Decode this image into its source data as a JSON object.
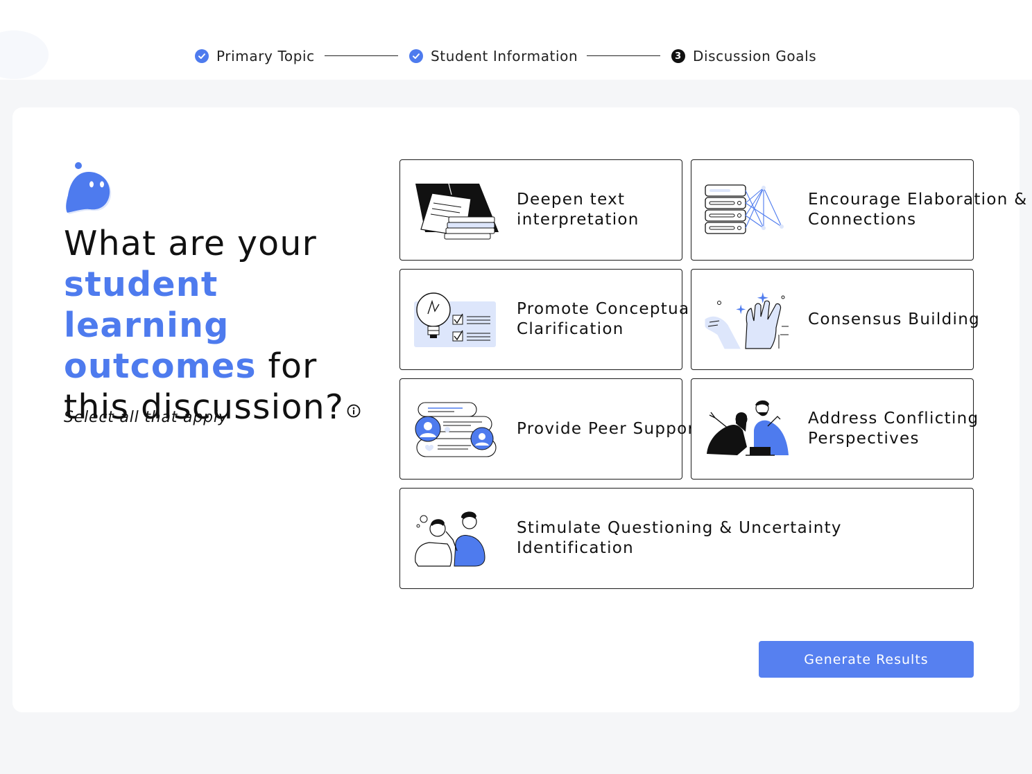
{
  "stepper": {
    "steps": [
      {
        "label": "Primary Topic",
        "state": "complete"
      },
      {
        "label": "Student Information",
        "state": "complete"
      },
      {
        "label": "Discussion Goals",
        "state": "current",
        "number": "3"
      }
    ]
  },
  "heading": {
    "part1": "What are your",
    "highlight": "student learning outcomes",
    "part2": "for",
    "part3": "this discussion?"
  },
  "subtext": "Select all that apply",
  "options": [
    {
      "label": "Deepen text interpretation",
      "icon": "books-papers-icon"
    },
    {
      "label": "Encourage Elaboration & Connections",
      "icon": "network-database-icon"
    },
    {
      "label": "Promote Conceptual Clarification",
      "icon": "lightbulb-checklist-icon"
    },
    {
      "label": "Consensus Building",
      "icon": "hands-high-five-icon"
    },
    {
      "label": "Provide Peer Support",
      "icon": "chat-bubbles-icon"
    },
    {
      "label": "Address Conflicting Perspectives",
      "icon": "people-debating-icon"
    },
    {
      "label": "Stimulate Questioning & Uncertainty Identification",
      "icon": "people-thinking-icon"
    }
  ],
  "generate_button": "Generate Results",
  "colors": {
    "accent": "#4e7bee",
    "button": "#5680f0",
    "background": "#f5f6f8",
    "illustration_light": "#dde6fb"
  }
}
